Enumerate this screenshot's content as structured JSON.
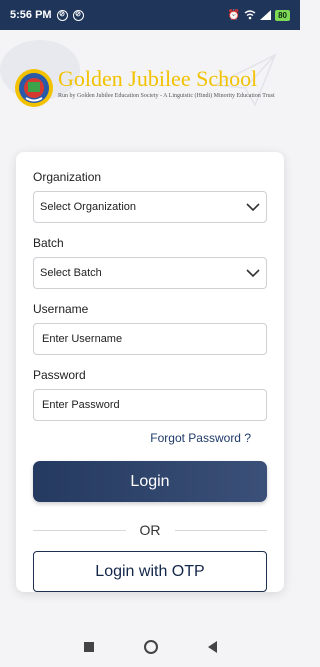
{
  "status_bar": {
    "time": "5:56 PM",
    "icons": [
      "data-saver-icon",
      "data-saver-icon",
      "alarm-icon",
      "wifi-icon",
      "signal-icon"
    ],
    "battery": "80"
  },
  "header": {
    "school_name": "Golden Jubilee School",
    "subtitle": "Run by Golden Jubilee Education Society - A Linguistic (Hindi) Minority Education Trust",
    "logo_icon": "school-crest-icon"
  },
  "form": {
    "organization": {
      "label": "Organization",
      "selected": "Select Organization"
    },
    "batch": {
      "label": "Batch",
      "selected": "Select Batch"
    },
    "username": {
      "label": "Username",
      "placeholder": "Enter Username"
    },
    "password": {
      "label": "Password",
      "placeholder": "Enter Password"
    },
    "forgot_label": "Forgot Password ?",
    "login_label": "Login",
    "or_label": "OR",
    "otp_label": "Login with OTP"
  },
  "colors": {
    "status_bar": "#1f355a",
    "brand_gold": "#f2c200",
    "primary_button": "#253a60",
    "link": "#1e3a6b"
  }
}
